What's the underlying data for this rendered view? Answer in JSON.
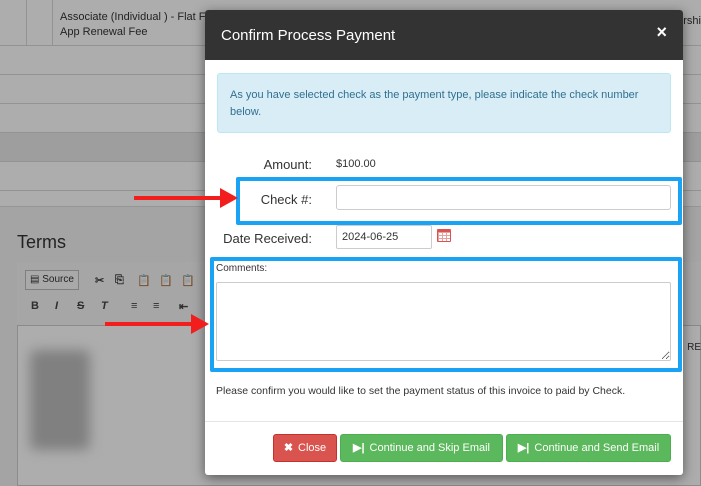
{
  "background": {
    "fee_line1": "Associate (Individual ) - Flat Fe",
    "fee_line2": "App Renewal Fee",
    "right_fragment": "rshi",
    "terms_title": "Terms",
    "toolbar": {
      "source_label": "Source"
    },
    "editor_fragment": "RE"
  },
  "modal": {
    "title": "Confirm Process Payment",
    "close_icon": "×",
    "info_message": "As you have selected check as the payment type, please indicate the check number below.",
    "amount_label": "Amount:",
    "amount_value": "$100.00",
    "check_label": "Check #:",
    "check_value": "",
    "date_label": "Date Received:",
    "date_value": "2024-06-25",
    "comments_label": "Comments:",
    "comments_value": "",
    "confirm_text": "Please confirm you would like to set the payment status of this invoice to paid by Check.",
    "buttons": {
      "close": "Close",
      "skip": "Continue and Skip Email",
      "send": "Continue and Send Email"
    }
  },
  "colors": {
    "header": "#333333",
    "info_bg": "#d9edf7",
    "danger": "#d9534f",
    "success": "#5cb85c",
    "highlight": "#1aa3f5",
    "arrow": "#f21e1e"
  }
}
